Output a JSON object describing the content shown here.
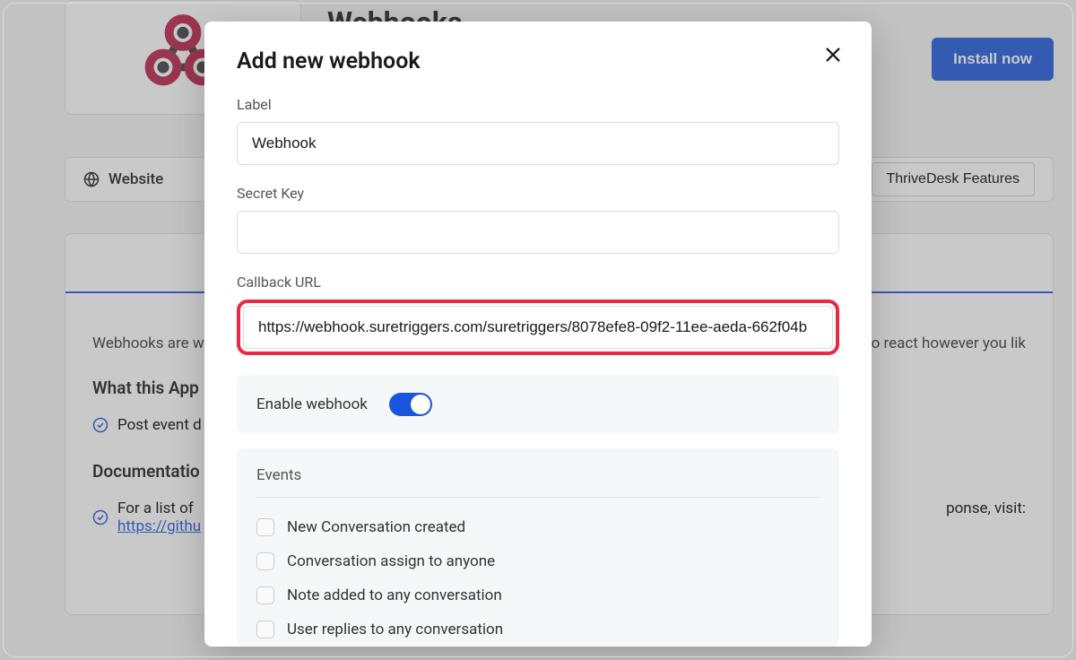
{
  "background": {
    "page_title": "Webhooks",
    "install_button": "Install now",
    "tab_website": "Website",
    "features_button": "ThriveDesk Features",
    "intro_text_start": "Webhooks are w",
    "intro_text_end": "enabling you to react however you lik",
    "section_heading": "What this App",
    "check_item_1": "Post event d",
    "doc_heading": "Documentatio",
    "doc_text_start": "For a list of",
    "doc_text_end": "ponse, visit:",
    "doc_link": "https://githu"
  },
  "modal": {
    "title": "Add new webhook",
    "fields": {
      "label": {
        "label": "Label",
        "value": "Webhook"
      },
      "secret_key": {
        "label": "Secret Key",
        "value": ""
      },
      "callback_url": {
        "label": "Callback URL",
        "value": "https://webhook.suretriggers.com/suretriggers/8078efe8-09f2-11ee-aeda-662f04b"
      }
    },
    "enable_webhook_label": "Enable webhook",
    "enable_webhook_value": true,
    "events_title": "Events",
    "events": [
      "New Conversation created",
      "Conversation assign to anyone",
      "Note added to any conversation",
      "User replies to any conversation"
    ]
  }
}
